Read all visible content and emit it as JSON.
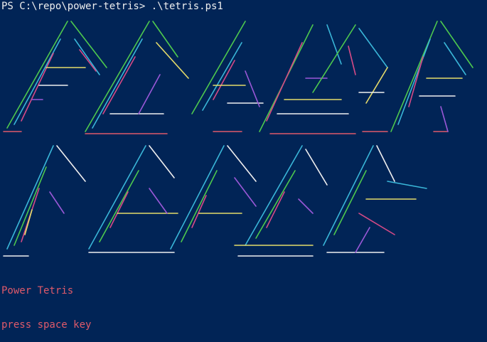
{
  "terminal": {
    "prompt": "PS C:\\repo\\power-tetris> .\\tetris.ps1",
    "background": "#012456"
  },
  "game": {
    "title": "Power Tetris",
    "instruction": "press space key",
    "text_color": "#e05a6a"
  },
  "art_palette": [
    "#4ec94e",
    "#3ab6d8",
    "#d64a86",
    "#e6dc6a",
    "#f0f0f0",
    "#9a58d8",
    "#e05a6a"
  ]
}
